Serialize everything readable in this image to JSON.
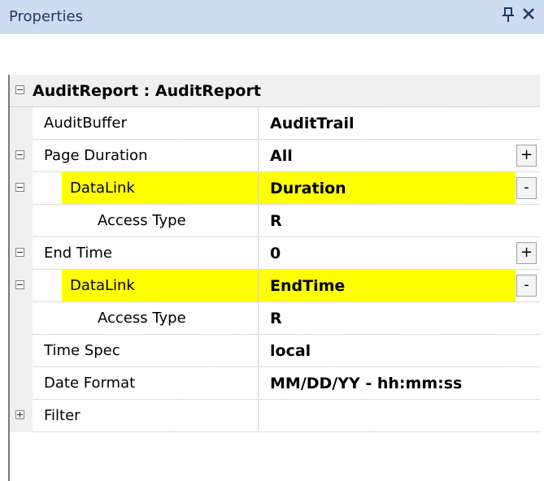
{
  "panel": {
    "title": "Properties",
    "pin_glyph": "ྡ",
    "close_glyph": "✕"
  },
  "toolbar": {
    "icons": [
      "categorized-view-icon",
      "add-property-icon",
      "remove-property-icon"
    ]
  },
  "grid": {
    "header": "AuditReport : AuditReport",
    "rows": [
      {
        "name": "AuditBuffer",
        "value": "AuditTrail"
      },
      {
        "name": "Page Duration",
        "value": "All",
        "button": "+"
      },
      {
        "name": "DataLink",
        "value": "Duration",
        "button": "-"
      },
      {
        "name": "Access Type",
        "value": "R"
      },
      {
        "name": "End Time",
        "value": "0",
        "button": "+"
      },
      {
        "name": "DataLink",
        "value": "EndTime",
        "button": "-"
      },
      {
        "name": "Access Type",
        "value": "R"
      },
      {
        "name": "Time Spec",
        "value": "local"
      },
      {
        "name": "Date Format",
        "value": "MM/DD/YY - hh:mm:ss"
      },
      {
        "name": "Filter",
        "value": ""
      }
    ]
  },
  "colors": {
    "titlebar": "#cddcf0",
    "highlight": "#ffff00"
  }
}
